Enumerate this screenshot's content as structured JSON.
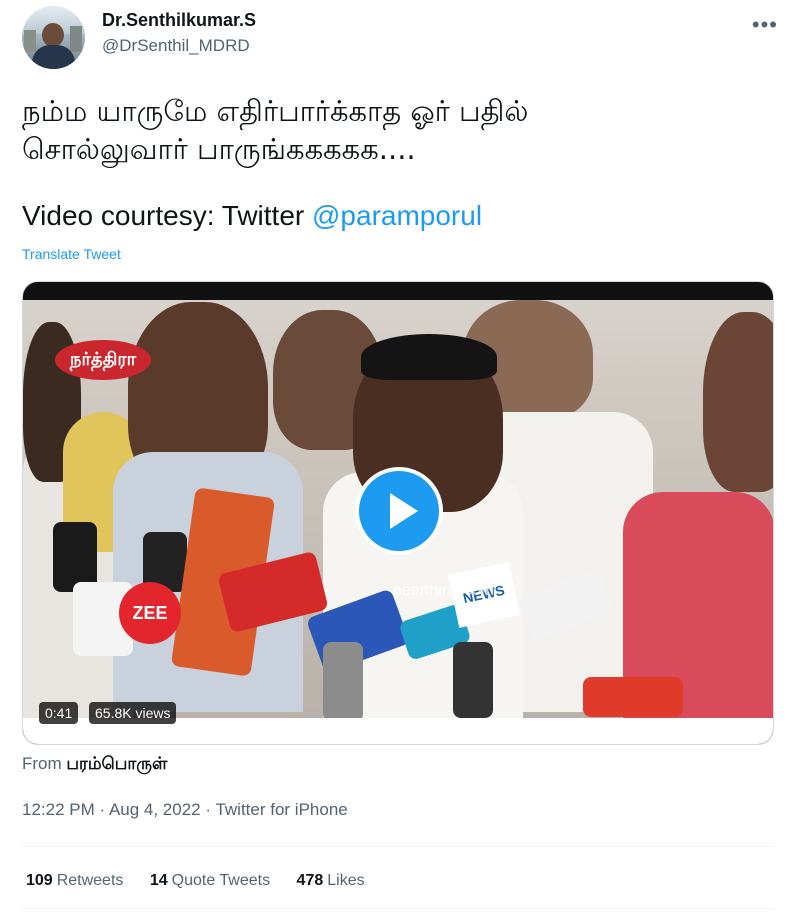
{
  "user": {
    "name": "Dr.Senthilkumar.S",
    "handle": "@DrSenthil_MDRD"
  },
  "more_icon": "more-horizontal-icon",
  "tweet": {
    "line1": "நம்ம யாருமே எதிர்பார்க்காத ஓர் பதில்",
    "line2": "சொல்லுவார் பாருங்ககககக....",
    "courtesy_prefix": "Video courtesy: Twitter ",
    "courtesy_mention": "@paramporul",
    "translate_label": "Translate Tweet"
  },
  "media": {
    "duration": "0:41",
    "views": "65.8K views",
    "channel_logo_text": "நர்த்திரா",
    "zee_label": "ZEE",
    "news_label": "NEWS",
    "watermark": "neerthirai.com",
    "play_icon": "play-icon"
  },
  "from": {
    "label": "From",
    "source": "பரம்பொருள்"
  },
  "meta": {
    "time": "12:22 PM",
    "sep1": " · ",
    "date": "Aug 4, 2022",
    "sep2": " · ",
    "client": "Twitter for iPhone"
  },
  "stats": {
    "retweets_count": "109",
    "retweets_label": "Retweets",
    "quotes_count": "14",
    "quotes_label": "Quote Tweets",
    "likes_count": "478",
    "likes_label": "Likes"
  },
  "colors": {
    "accent": "#1d9bf0",
    "text": "#0f1419",
    "secondary": "#536471"
  }
}
